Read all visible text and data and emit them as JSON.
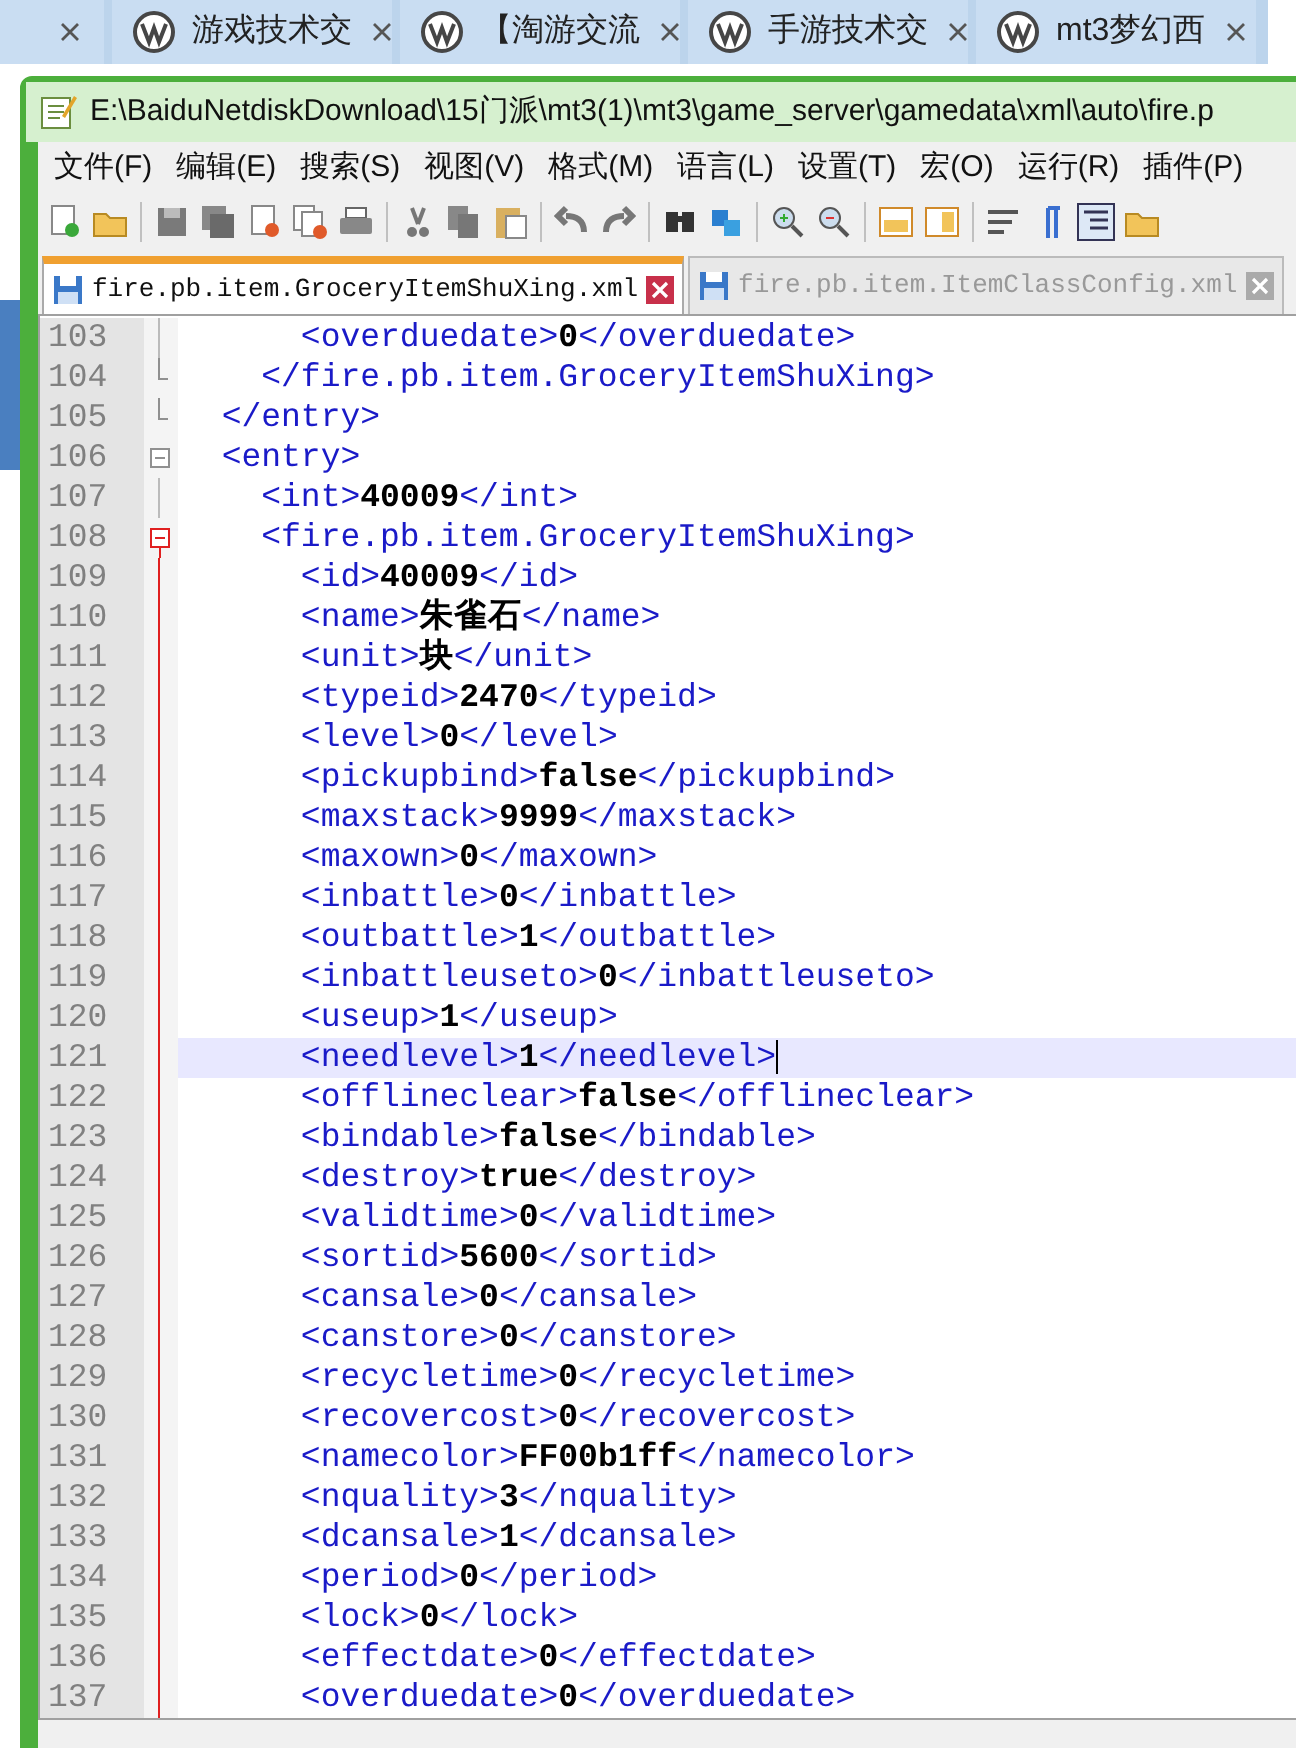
{
  "browser_tabs": [
    {
      "selected": false
    },
    {
      "title": "游戏技术交",
      "selected": false
    },
    {
      "title": "【淘游交流",
      "selected": false
    },
    {
      "title": "手游技术交",
      "selected": false
    },
    {
      "title": "mt3梦幻西",
      "selected": false
    }
  ],
  "window": {
    "title": "E:\\BaiduNetdiskDownload\\15门派\\mt3(1)\\mt3\\game_server\\gamedata\\xml\\auto\\fire.p"
  },
  "menu": [
    "文件(F)",
    "编辑(E)",
    "搜索(S)",
    "视图(V)",
    "格式(M)",
    "语言(L)",
    "设置(T)",
    "宏(O)",
    "运行(R)",
    "插件(P)"
  ],
  "file_tabs": [
    {
      "label": "fire.pb.item.GroceryItemShuXing.xml",
      "selected": true
    },
    {
      "label": "fire.pb.item.ItemClassConfig.xml",
      "selected": false
    }
  ],
  "editor": {
    "lines": [
      {
        "number": "103",
        "fold_box": false,
        "fold_end": false,
        "in_caret_block": false,
        "current": false,
        "code": "      <overduedate>0</overduedate>"
      },
      {
        "number": "104",
        "fold_box": false,
        "fold_end": true,
        "in_caret_block": false,
        "current": false,
        "code": "    </fire.pb.item.GroceryItemShuXing>"
      },
      {
        "number": "105",
        "fold_box": false,
        "fold_end": true,
        "in_caret_block": false,
        "current": false,
        "code": "  </entry>"
      },
      {
        "number": "106",
        "fold_box": true,
        "fold_end": false,
        "in_caret_block": false,
        "current": false,
        "code": "  <entry>"
      },
      {
        "number": "107",
        "fold_box": false,
        "fold_end": false,
        "in_caret_block": false,
        "current": false,
        "code": "    <int>40009</int>"
      },
      {
        "number": "108",
        "fold_box": true,
        "fold_end": false,
        "in_caret_block": true,
        "current": false,
        "code": "    <fire.pb.item.GroceryItemShuXing>"
      },
      {
        "number": "109",
        "fold_box": false,
        "fold_end": false,
        "in_caret_block": true,
        "current": false,
        "code": "      <id>40009</id>"
      },
      {
        "number": "110",
        "fold_box": false,
        "fold_end": false,
        "in_caret_block": true,
        "current": false,
        "code": "      <name>朱雀石</name>"
      },
      {
        "number": "111",
        "fold_box": false,
        "fold_end": false,
        "in_caret_block": true,
        "current": false,
        "code": "      <unit>块</unit>"
      },
      {
        "number": "112",
        "fold_box": false,
        "fold_end": false,
        "in_caret_block": true,
        "current": false,
        "code": "      <typeid>2470</typeid>"
      },
      {
        "number": "113",
        "fold_box": false,
        "fold_end": false,
        "in_caret_block": true,
        "current": false,
        "code": "      <level>0</level>"
      },
      {
        "number": "114",
        "fold_box": false,
        "fold_end": false,
        "in_caret_block": true,
        "current": false,
        "code": "      <pickupbind>false</pickupbind>"
      },
      {
        "number": "115",
        "fold_box": false,
        "fold_end": false,
        "in_caret_block": true,
        "current": false,
        "code": "      <maxstack>9999</maxstack>"
      },
      {
        "number": "116",
        "fold_box": false,
        "fold_end": false,
        "in_caret_block": true,
        "current": false,
        "code": "      <maxown>0</maxown>"
      },
      {
        "number": "117",
        "fold_box": false,
        "fold_end": false,
        "in_caret_block": true,
        "current": false,
        "code": "      <inbattle>0</inbattle>"
      },
      {
        "number": "118",
        "fold_box": false,
        "fold_end": false,
        "in_caret_block": true,
        "current": false,
        "code": "      <outbattle>1</outbattle>"
      },
      {
        "number": "119",
        "fold_box": false,
        "fold_end": false,
        "in_caret_block": true,
        "current": false,
        "code": "      <inbattleuseto>0</inbattleuseto>"
      },
      {
        "number": "120",
        "fold_box": false,
        "fold_end": false,
        "in_caret_block": true,
        "current": false,
        "code": "      <useup>1</useup>"
      },
      {
        "number": "121",
        "fold_box": false,
        "fold_end": false,
        "in_caret_block": true,
        "current": true,
        "code": "      <needlevel>1</needlevel>"
      },
      {
        "number": "122",
        "fold_box": false,
        "fold_end": false,
        "in_caret_block": true,
        "current": false,
        "code": "      <offlineclear>false</offlineclear>"
      },
      {
        "number": "123",
        "fold_box": false,
        "fold_end": false,
        "in_caret_block": true,
        "current": false,
        "code": "      <bindable>false</bindable>"
      },
      {
        "number": "124",
        "fold_box": false,
        "fold_end": false,
        "in_caret_block": true,
        "current": false,
        "code": "      <destroy>true</destroy>"
      },
      {
        "number": "125",
        "fold_box": false,
        "fold_end": false,
        "in_caret_block": true,
        "current": false,
        "code": "      <validtime>0</validtime>"
      },
      {
        "number": "126",
        "fold_box": false,
        "fold_end": false,
        "in_caret_block": true,
        "current": false,
        "code": "      <sortid>5600</sortid>"
      },
      {
        "number": "127",
        "fold_box": false,
        "fold_end": false,
        "in_caret_block": true,
        "current": false,
        "code": "      <cansale>0</cansale>"
      },
      {
        "number": "128",
        "fold_box": false,
        "fold_end": false,
        "in_caret_block": true,
        "current": false,
        "code": "      <canstore>0</canstore>"
      },
      {
        "number": "129",
        "fold_box": false,
        "fold_end": false,
        "in_caret_block": true,
        "current": false,
        "code": "      <recycletime>0</recycletime>"
      },
      {
        "number": "130",
        "fold_box": false,
        "fold_end": false,
        "in_caret_block": true,
        "current": false,
        "code": "      <recovercost>0</recovercost>"
      },
      {
        "number": "131",
        "fold_box": false,
        "fold_end": false,
        "in_caret_block": true,
        "current": false,
        "code": "      <namecolor>FF00b1ff</namecolor>"
      },
      {
        "number": "132",
        "fold_box": false,
        "fold_end": false,
        "in_caret_block": true,
        "current": false,
        "code": "      <nquality>3</nquality>"
      },
      {
        "number": "133",
        "fold_box": false,
        "fold_end": false,
        "in_caret_block": true,
        "current": false,
        "code": "      <dcansale>1</dcansale>"
      },
      {
        "number": "134",
        "fold_box": false,
        "fold_end": false,
        "in_caret_block": true,
        "current": false,
        "code": "      <period>0</period>"
      },
      {
        "number": "135",
        "fold_box": false,
        "fold_end": false,
        "in_caret_block": true,
        "current": false,
        "code": "      <lock>0</lock>"
      },
      {
        "number": "136",
        "fold_box": false,
        "fold_end": false,
        "in_caret_block": true,
        "current": false,
        "code": "      <effectdate>0</effectdate>"
      },
      {
        "number": "137",
        "fold_box": false,
        "fold_end": false,
        "in_caret_block": true,
        "current": false,
        "code": "      <overduedate>0</overduedate>"
      }
    ]
  }
}
